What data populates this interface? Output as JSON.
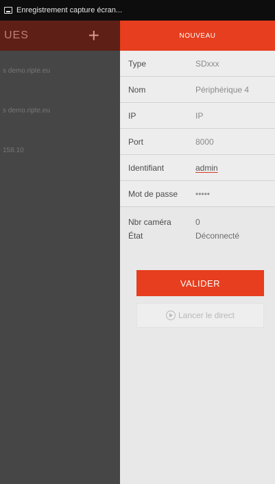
{
  "status_bar": {
    "text": "Enregistrement capture écran..."
  },
  "drawer": {
    "title": "UES",
    "add_label": "+",
    "items": [
      {
        "label": "s demo.ripte.eu"
      },
      {
        "label": "s demo.ripte.eu"
      },
      {
        "label": "158.10"
      }
    ]
  },
  "panel": {
    "title": "NOUVEAU",
    "fields": [
      {
        "label": "Type",
        "value": "SDxxx"
      },
      {
        "label": "Nom",
        "value": "Périphérique 4"
      },
      {
        "label": "IP",
        "value": "IP"
      },
      {
        "label": "Port",
        "value": "8000"
      },
      {
        "label": "Identifiant",
        "value": "admin"
      },
      {
        "label": "Mot de passe",
        "value": "•••••"
      }
    ],
    "info": [
      {
        "label": "Nbr caméra",
        "value": "0"
      },
      {
        "label": "État",
        "value": "Déconnecté"
      }
    ],
    "validate_label": "VALIDER",
    "live_label": "Lancer le direct"
  },
  "colors": {
    "accent": "#e63e1e",
    "panel_bg": "#e8e8e8",
    "drawer_bg": "#464646"
  }
}
